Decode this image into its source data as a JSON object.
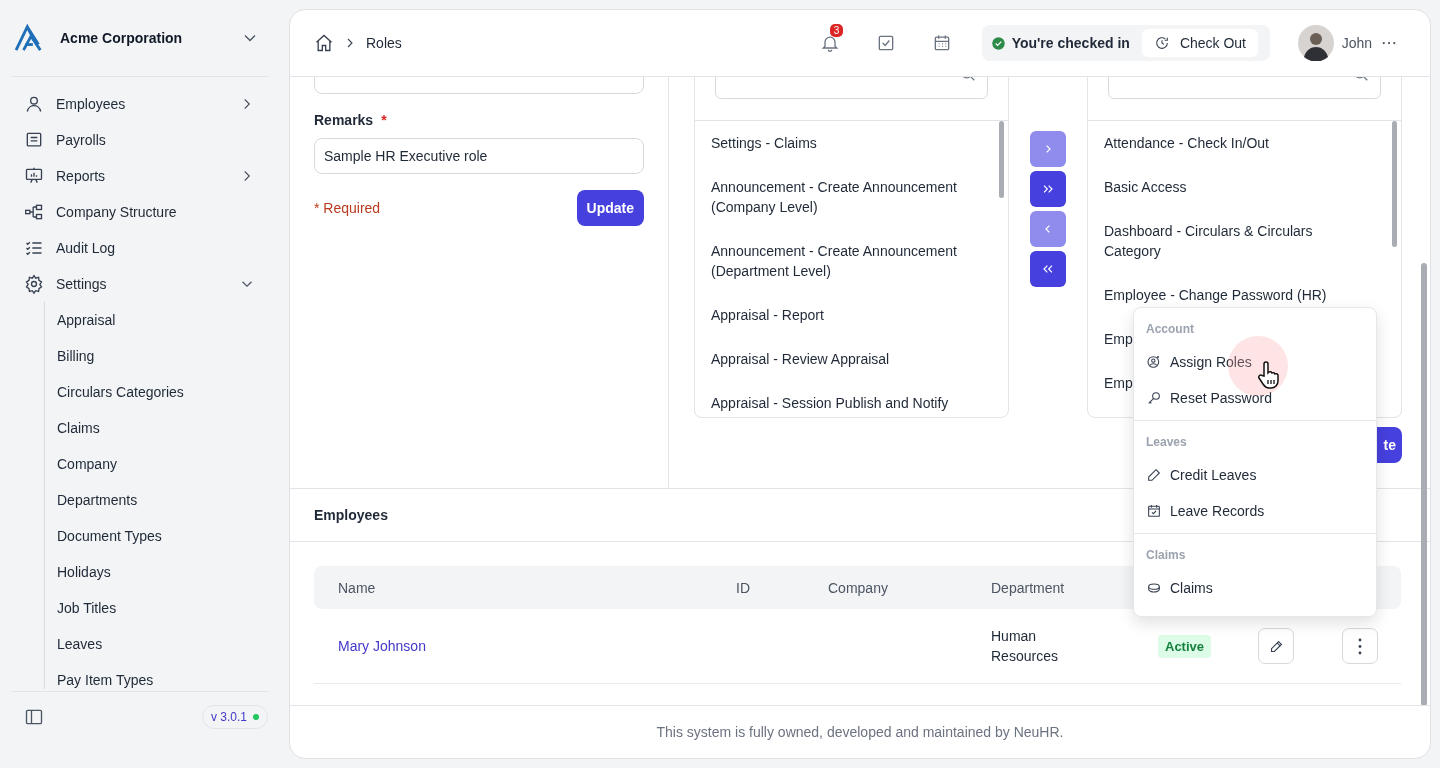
{
  "sidebar": {
    "company": "Acme Corporation",
    "nav": [
      {
        "label": "Employees",
        "expanded": false
      },
      {
        "label": "Payrolls"
      },
      {
        "label": "Reports",
        "expanded": false
      },
      {
        "label": "Company Structure"
      },
      {
        "label": "Audit Log"
      },
      {
        "label": "Settings",
        "expanded": true,
        "children": [
          "Appraisal",
          "Billing",
          "Circulars Categories",
          "Claims",
          "Company",
          "Departments",
          "Document Types",
          "Holidays",
          "Job Titles",
          "Leaves",
          "Pay Item Types"
        ]
      }
    ],
    "version": "v 3.0.1"
  },
  "header": {
    "breadcrumb": "Roles",
    "notification_count": "3",
    "check_status": "You're checked in",
    "check_out": "Check Out",
    "user_name": "John"
  },
  "role_form": {
    "remarks_label": "Remarks",
    "required_mark": "*",
    "remarks_value": "Sample HR Executive role",
    "required_note": "* Required",
    "update_label": "Update"
  },
  "permissions": {
    "available": [
      "Settings - Claims",
      "Announcement - Create Announcement (Company Level)",
      "Announcement - Create Announcement (Department Level)",
      "Appraisal - Report",
      "Appraisal - Review Appraisal",
      "Appraisal - Session Publish and Notify"
    ],
    "transfer_buttons": [
      {
        "kind": "one_right",
        "disabled": true
      },
      {
        "kind": "all_right",
        "disabled": false
      },
      {
        "kind": "one_left",
        "disabled": true
      },
      {
        "kind": "all_left",
        "disabled": false
      }
    ],
    "assigned": [
      "Attendance - Check In/Out",
      "Basic Access",
      "Dashboard - Circulars & Circulars Category",
      "Employee - Change Password (HR)",
      "Emp",
      "Emp"
    ],
    "update_label": "te"
  },
  "employees": {
    "title": "Employees",
    "columns": [
      "Name",
      "ID",
      "Company",
      "Department"
    ],
    "rows": [
      {
        "name": "Mary Johnson",
        "department": "Human Resources",
        "status": "Active"
      }
    ]
  },
  "row_menu": {
    "sections": [
      {
        "title": "Account",
        "items": [
          {
            "label": "Assign Roles",
            "hovered": true
          },
          {
            "label": "Reset Password",
            "hovered": false
          }
        ]
      },
      {
        "title": "Leaves",
        "items": [
          {
            "label": "Credit Leaves",
            "hovered": false
          },
          {
            "label": "Leave Records",
            "hovered": false
          }
        ]
      },
      {
        "title": "Claims",
        "items": [
          {
            "label": "Claims",
            "hovered": false
          }
        ]
      }
    ]
  },
  "footer": "This system is fully owned, developed and maintained by NeuHR."
}
